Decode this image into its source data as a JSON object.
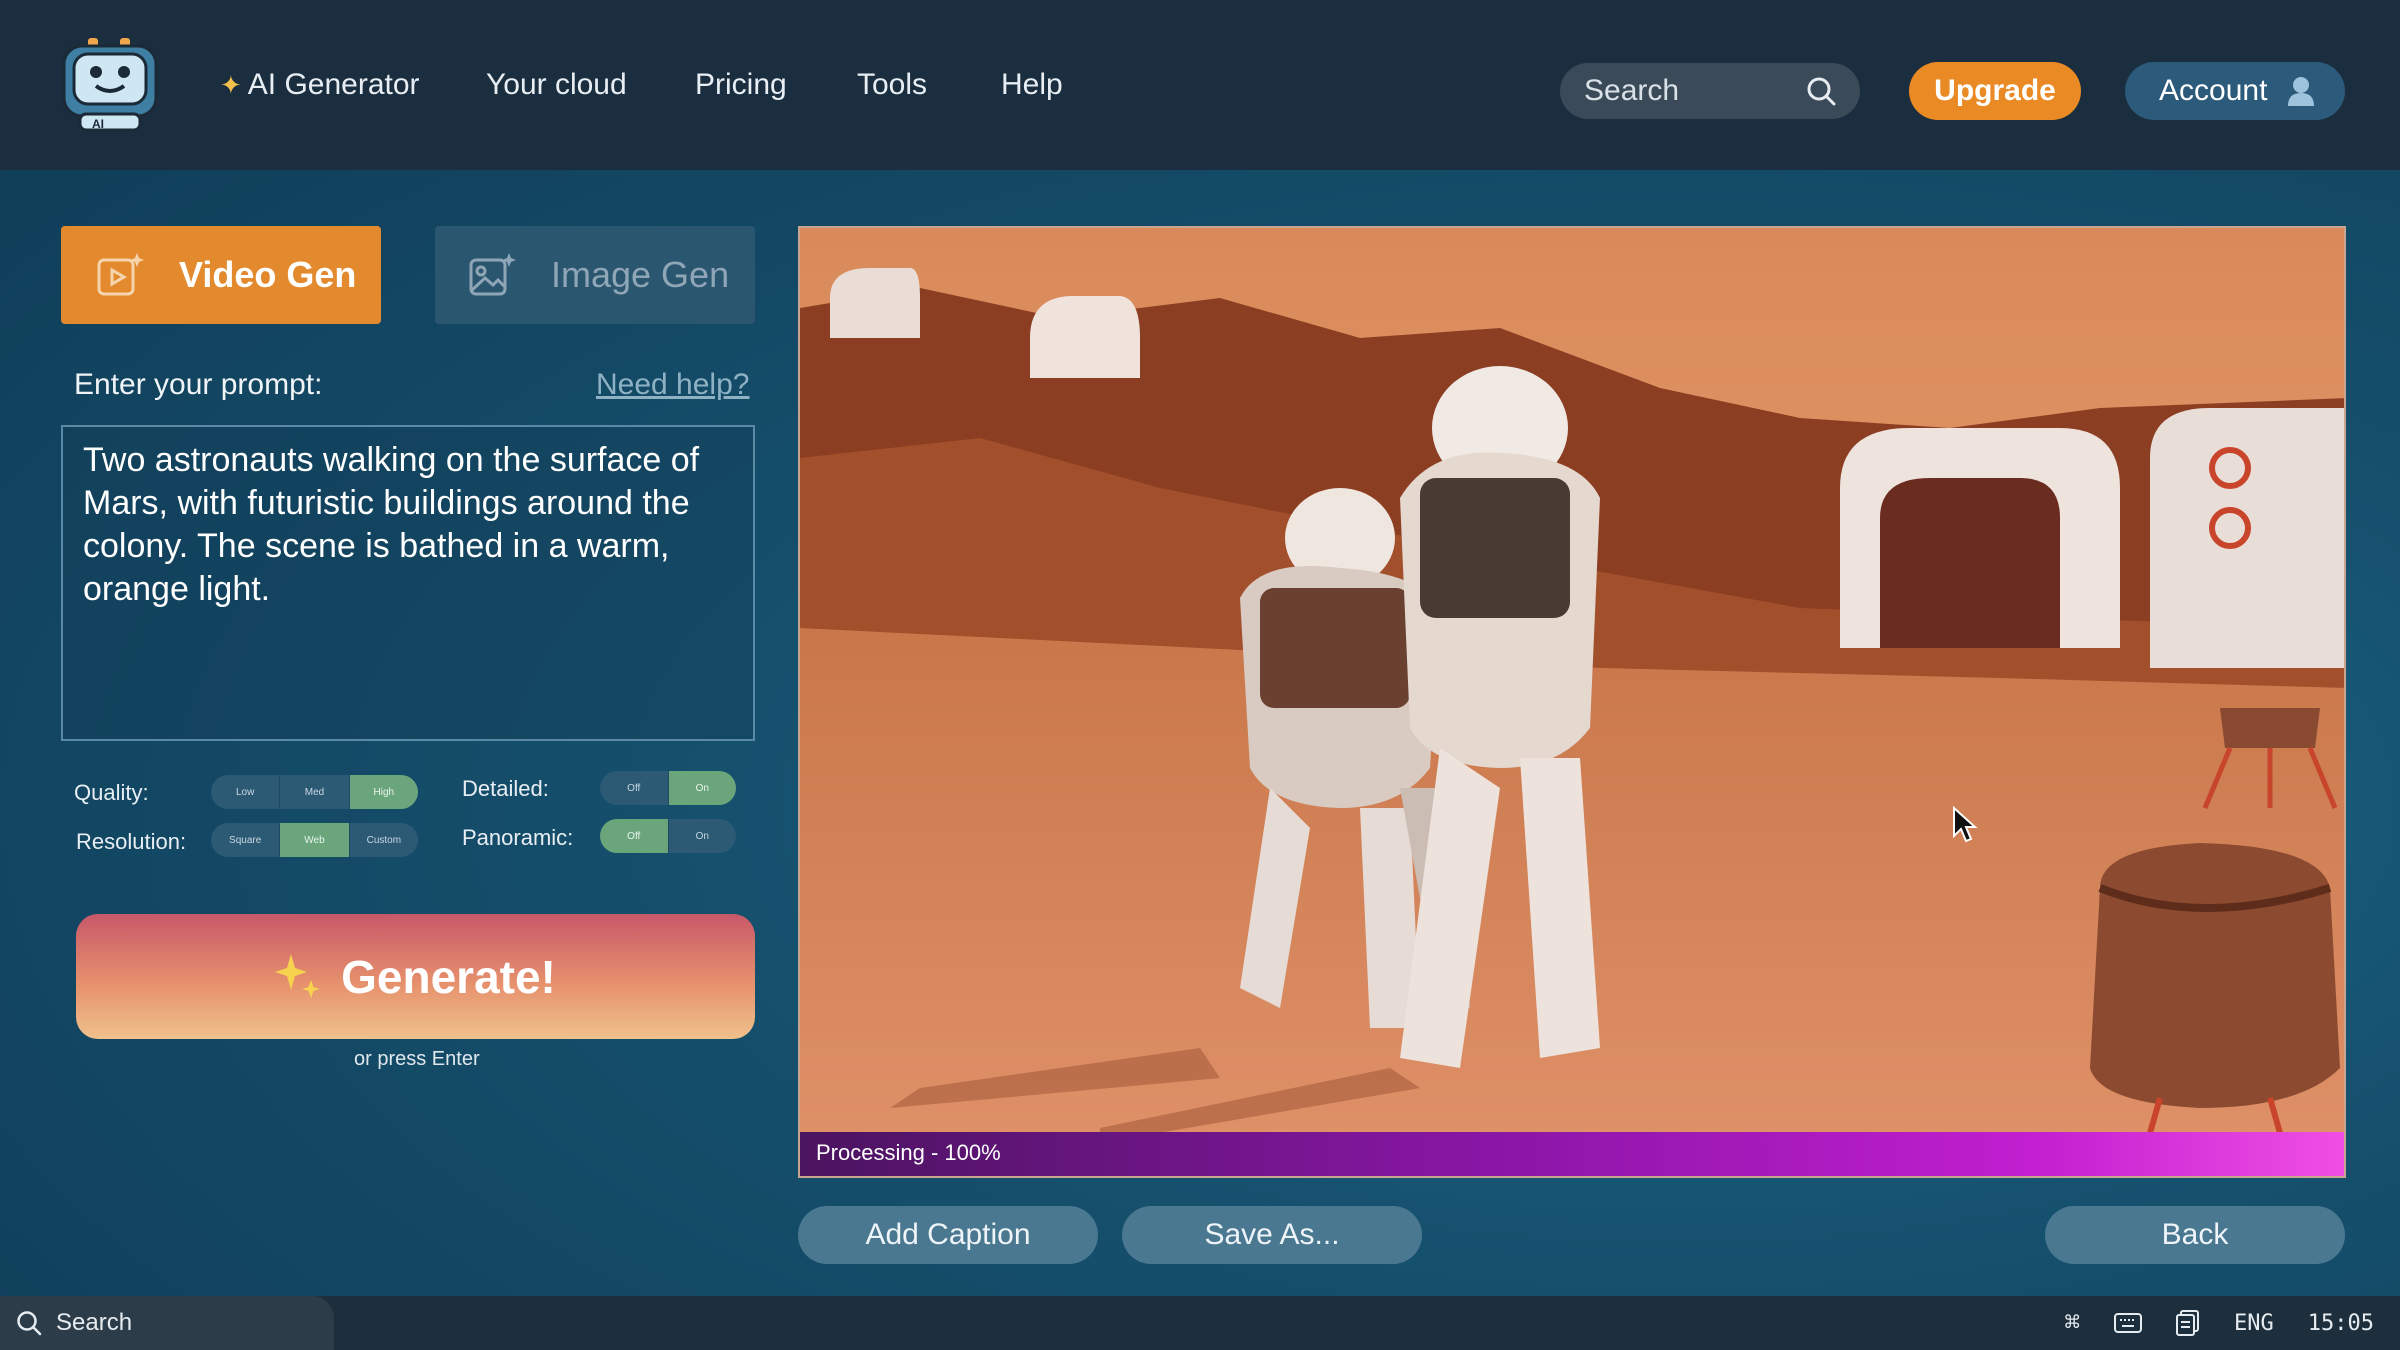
{
  "nav": {
    "items": [
      "AI Generator",
      "Your cloud",
      "Pricing",
      "Tools",
      "Help"
    ],
    "search_placeholder": "Search",
    "upgrade_label": "Upgrade",
    "account_label": "Account",
    "logo_badge": "AI"
  },
  "tabs": {
    "video": "Video Gen",
    "image": "Image Gen",
    "active": "video"
  },
  "prompt": {
    "label": "Enter your prompt:",
    "help_link": "Need help?",
    "text": "Two astronauts walking on the surface of Mars, with futuristic buildings around the colony. The scene is bathed in a warm, orange light."
  },
  "options": {
    "quality": {
      "label": "Quality:",
      "choices": [
        "Low",
        "Med",
        "High"
      ],
      "selected": "High"
    },
    "resolution": {
      "label": "Resolution:",
      "choices": [
        "Square",
        "Web",
        "Custom"
      ],
      "selected": "Web"
    },
    "detailed": {
      "label": "Detailed:",
      "choices": [
        "Off",
        "On"
      ],
      "selected": "On"
    },
    "panoramic": {
      "label": "Panoramic:",
      "choices": [
        "Off",
        "On"
      ],
      "selected": "Off"
    }
  },
  "generate": {
    "label": "Generate!",
    "hint": "or press Enter"
  },
  "preview": {
    "status": "Processing - 100%",
    "progress_percent": 100
  },
  "actions": {
    "add_caption": "Add Caption",
    "save_as": "Save As...",
    "back": "Back"
  },
  "taskbar": {
    "search_label": "Search",
    "language": "ENG",
    "time": "15:05"
  },
  "colors": {
    "accent_orange": "#e48a2e",
    "nav_bg": "#1b2e3f",
    "account_blue": "#2b5a7b",
    "toggle_active": "#6aa57c",
    "progress_purple": "#c21fd0"
  }
}
